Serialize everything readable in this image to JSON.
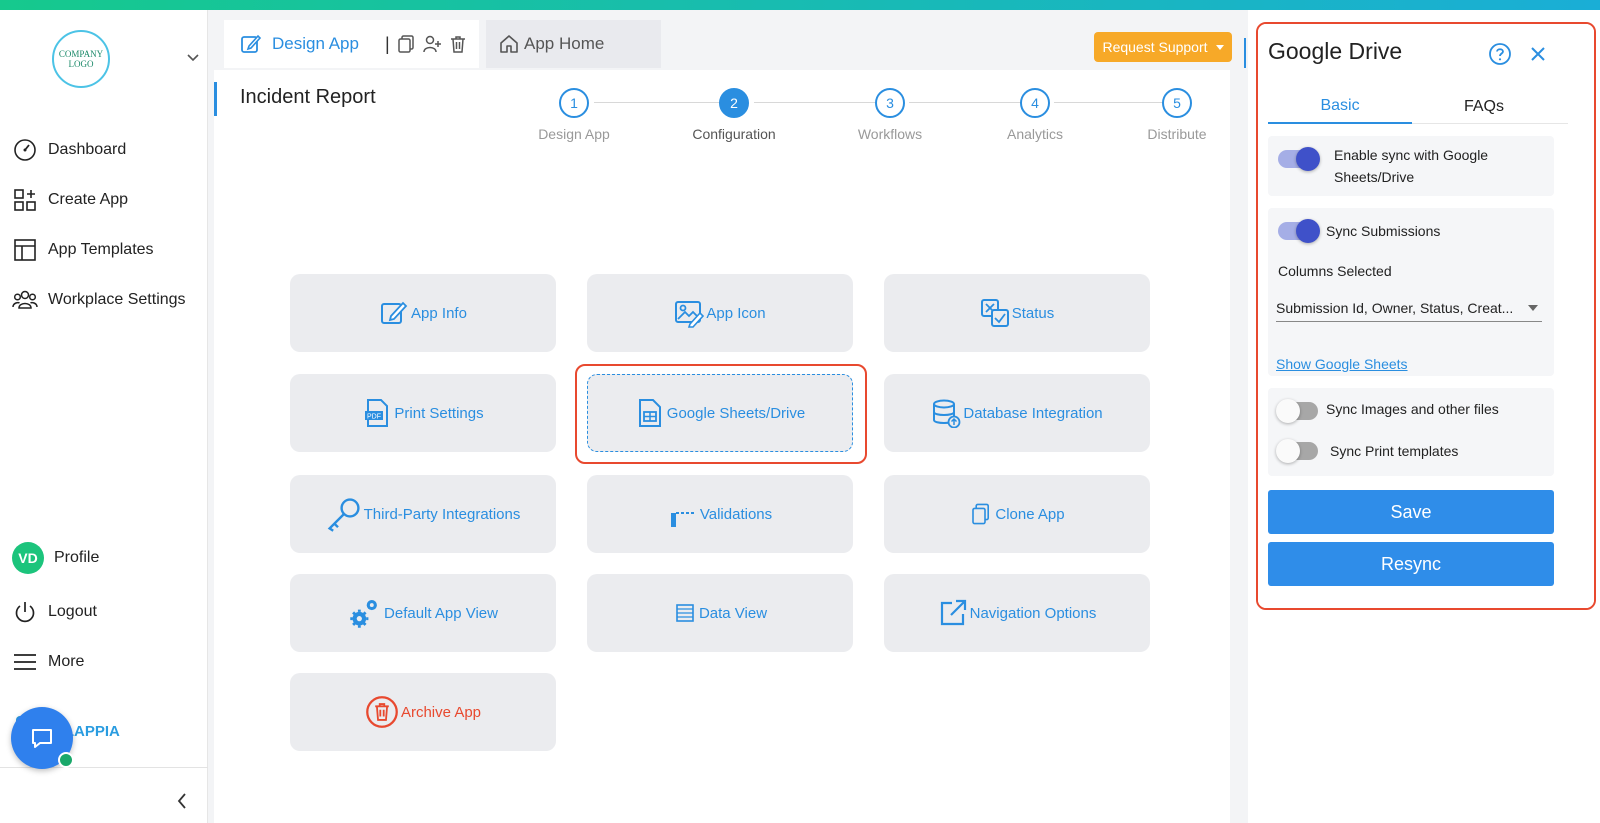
{
  "sidebar": {
    "logo_text": "COMPANY LOGO",
    "nav": [
      {
        "label": "Dashboard",
        "icon": "dashboard-gauge-icon"
      },
      {
        "label": "Create App",
        "icon": "create-app-grid-icon"
      },
      {
        "label": "App Templates",
        "icon": "templates-layout-icon"
      },
      {
        "label": "Workplace Settings",
        "icon": "team-users-icon"
      }
    ],
    "profile": {
      "initials": "VD",
      "label": "Profile"
    },
    "logout_label": "Logout",
    "more_label": "More",
    "brand_label": "CLAPPIA"
  },
  "tabs": {
    "active_label": "Design App",
    "separator": "|",
    "home_label": "App Home"
  },
  "support_label": "Request Support",
  "page_title": "Incident Report",
  "steps": [
    {
      "number": "1",
      "label": "Design App",
      "active": false
    },
    {
      "number": "2",
      "label": "Configuration",
      "active": true
    },
    {
      "number": "3",
      "label": "Workflows",
      "active": false
    },
    {
      "number": "4",
      "label": "Analytics",
      "active": false
    },
    {
      "number": "5",
      "label": "Distribute",
      "active": false
    }
  ],
  "tiles": [
    {
      "label": "App Info",
      "icon": "edit-icon"
    },
    {
      "label": "App Icon",
      "icon": "image-edit-icon"
    },
    {
      "label": "Status",
      "icon": "status-check-icon"
    },
    {
      "label": "Print Settings",
      "icon": "pdf-icon"
    },
    {
      "label": "Google Sheets/Drive",
      "icon": "sheet-icon",
      "selected": true
    },
    {
      "label": "Database Integration",
      "icon": "database-icon"
    },
    {
      "label": "Third-Party Integrations",
      "icon": "key-icon"
    },
    {
      "label": "Validations",
      "icon": "validation-icon"
    },
    {
      "label": "Clone App",
      "icon": "copy-icon"
    },
    {
      "label": "Default App View",
      "icon": "gears-icon"
    },
    {
      "label": "Data View",
      "icon": "table-icon"
    },
    {
      "label": "Navigation Options",
      "icon": "external-link-icon"
    },
    {
      "label": "Archive App",
      "icon": "trash-circle-icon",
      "danger": true
    }
  ],
  "panel": {
    "title": "Google Drive",
    "tabs": [
      "Basic",
      "FAQs"
    ],
    "enable_sync_label": "Enable sync with Google Sheets/Drive",
    "enable_sync_on": true,
    "sync_submissions_label": "Sync Submissions",
    "sync_submissions_on": true,
    "columns_label": "Columns Selected",
    "columns_value": "Submission Id, Owner, Status, Creat...",
    "show_sheets_link": "Show Google Sheets",
    "sync_images_label": "Sync Images and other files",
    "sync_images_on": false,
    "sync_print_label": "Sync Print templates",
    "sync_print_on": false,
    "save_label": "Save",
    "resync_label": "Resync"
  },
  "colors": {
    "accent": "#2a8ee0",
    "warning": "#f7a928",
    "danger": "#e8492f",
    "toggle_on": "#3f51c9"
  }
}
